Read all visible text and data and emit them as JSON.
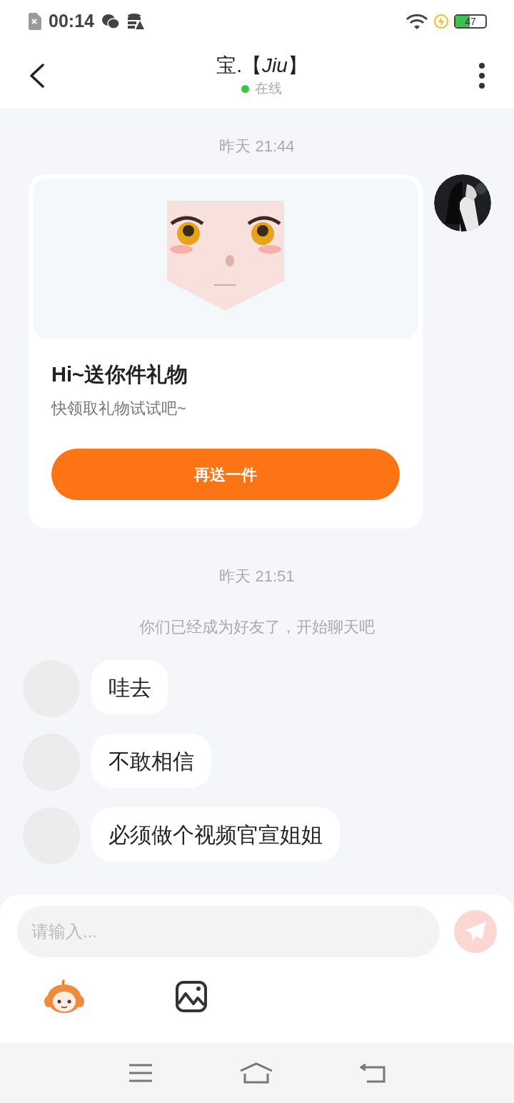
{
  "status_bar": {
    "time": "00:14",
    "battery": "47",
    "charging": true
  },
  "header": {
    "title": "宝.【*Jiu*】",
    "status": "在线",
    "online": true
  },
  "messages": [
    {
      "kind": "time",
      "text": "昨天 21:44"
    },
    {
      "kind": "gift",
      "title": "Hi~送你件礼物",
      "subtitle": "快领取礼物试试吧~",
      "button": "再送一件"
    },
    {
      "kind": "time",
      "text": "昨天 21:51"
    },
    {
      "kind": "notice",
      "text": "你们已经成为好友了，开始聊天吧"
    },
    {
      "kind": "incoming",
      "text": "哇去"
    },
    {
      "kind": "incoming",
      "text": "不敢相信"
    },
    {
      "kind": "incoming",
      "text": "必须做个视频官宣姐姐"
    }
  ],
  "composer": {
    "placeholder": "请输入..."
  }
}
